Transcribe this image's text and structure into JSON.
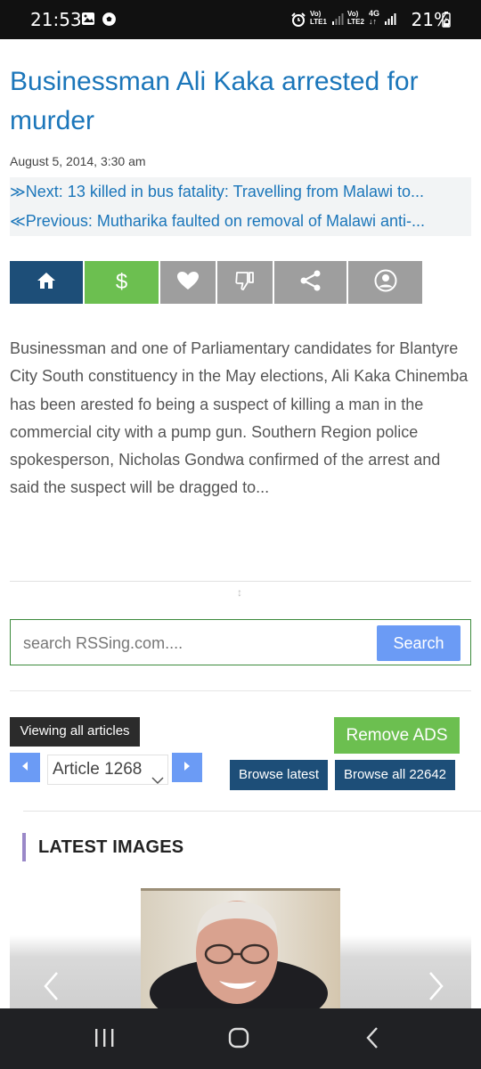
{
  "status_bar": {
    "time": "21:53",
    "battery": "21%",
    "net1": "VoLTE1",
    "net2": "VoLTE2 4G"
  },
  "article": {
    "title": "Businessman Ali Kaka arrested for murder",
    "date": "August 5, 2014, 3:30 am",
    "next": "Next: 13 killed in bus fatality: Travelling from Malawi to...",
    "previous": "Previous: Mutharika faulted on removal of Malawi anti-...",
    "body": "Businessman and one of Parliamentary candidates for Blantyre City South constituency in the May  elections, Ali Kaka Chinemba has been arested fo being a suspect of killing a man in the commercial city with a pump gun. Southern Region police spokesperson, Nicholas Gondwa confirmed of the arrest and said the suspect will be dragged to..."
  },
  "share_bar": {
    "buttons": [
      {
        "icon": "home-icon",
        "color": "#1d4e78"
      },
      {
        "icon": "dollar-icon",
        "color": "#6cbf50"
      },
      {
        "icon": "heart-icon",
        "color": "#9e9e9e"
      },
      {
        "icon": "thumbs-down-icon",
        "color": "#9e9e9e"
      },
      {
        "icon": "share-icon",
        "color": "#9e9e9e"
      },
      {
        "icon": "user-icon",
        "color": "#9e9e9e"
      }
    ],
    "dollar_label": "$"
  },
  "search": {
    "placeholder": "search RSSing.com....",
    "button": "Search"
  },
  "pager": {
    "viewing": "Viewing all articles",
    "remove_ads": "Remove ADS",
    "article_select": "Article 1268",
    "browse_latest": "Browse latest",
    "browse_all": "Browse all 22642"
  },
  "latest_images": {
    "heading": "LATEST IMAGES"
  },
  "colors": {
    "link": "#1b76ba",
    "accent_green": "#6cbf50",
    "accent_blue": "#6b9bf5",
    "dark_blue": "#1d4e78"
  }
}
